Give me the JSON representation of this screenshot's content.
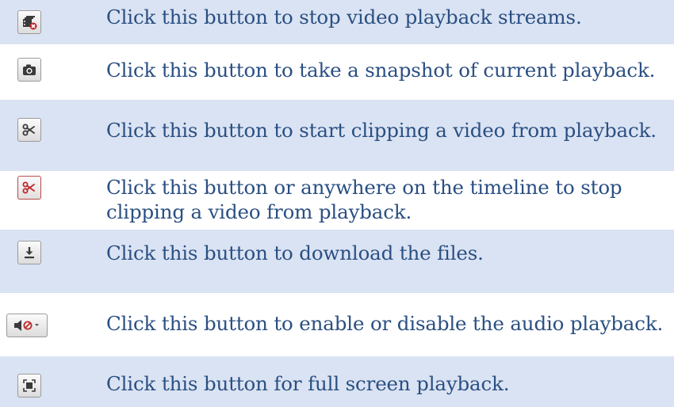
{
  "rows": [
    {
      "icon": "stop-playback-icon",
      "description": "Click this button to stop video playback streams."
    },
    {
      "icon": "camera-icon",
      "description": "Click this button to take a snapshot of current playback."
    },
    {
      "icon": "scissors-icon",
      "description": "Click this button to start clipping a video from playback."
    },
    {
      "icon": "scissors-red-icon",
      "description": "Click this button or anywhere on the timeline to stop clipping a video from playback."
    },
    {
      "icon": "download-icon",
      "description": "Click this button to download the files."
    },
    {
      "icon": "speaker-muted-icon",
      "description": "Click this button to enable or disable the audio playback."
    },
    {
      "icon": "fullscreen-icon",
      "description": "Click this button for full screen playback."
    }
  ],
  "colors": {
    "shaded_row": "#dae3f3",
    "text": "#2a4f82",
    "red_accent": "#c0282a"
  }
}
